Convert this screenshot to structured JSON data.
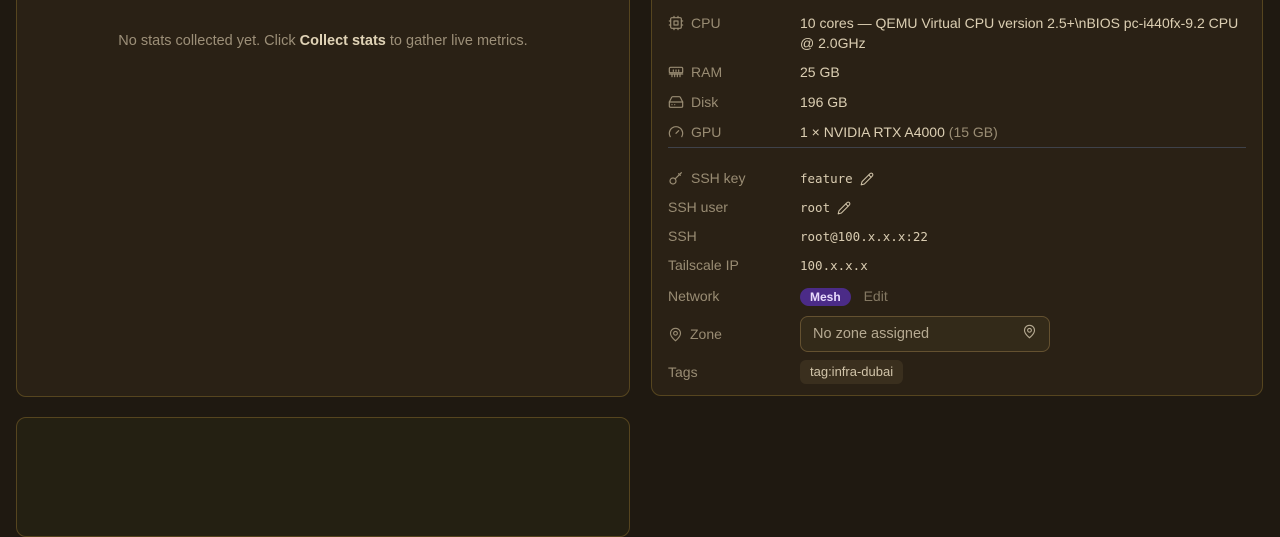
{
  "theme": {
    "page_bg": "#1f1911",
    "panel_bg": "#2a2115",
    "panel_border": "#56451f",
    "value_text": "#dbceb2",
    "label_text": "#998c73",
    "badge_bg": "#4b2b87",
    "badge_text": "#e7dafb"
  },
  "stats_panel": {
    "message_prefix": "No stats collected yet. Click ",
    "message_bold": "Collect stats",
    "message_suffix": " to gather live metrics."
  },
  "details_panel": {
    "hardware": {
      "cpu": {
        "icon": "cpu-icon",
        "label": "CPU",
        "value": "10 cores — QEMU Virtual CPU version 2.5+\\nBIOS pc-i440fx-9.2 CPU @ 2.0GHz"
      },
      "ram": {
        "icon": "ram-icon",
        "label": "RAM",
        "value": "25 GB"
      },
      "disk": {
        "icon": "disk-icon",
        "label": "Disk",
        "value": "196 GB"
      },
      "gpu": {
        "icon": "gpu-icon",
        "label": "GPU",
        "value": "1 × NVIDIA RTX A4000",
        "value_suffix": "(15 GB)"
      }
    },
    "connection": {
      "ssh_key": {
        "icon": "key-icon",
        "label": "SSH key",
        "value": "feature"
      },
      "ssh_user": {
        "label": "SSH user",
        "value": "root"
      },
      "ssh": {
        "label": "SSH",
        "value": "root@100.x.x.x:22"
      },
      "tailscale_ip": {
        "label": "Tailscale IP",
        "value": "100.x.x.x"
      }
    },
    "network": {
      "label": "Network",
      "badge": "Mesh",
      "edit_label": "Edit"
    },
    "zone": {
      "icon": "map-pin-icon",
      "label": "Zone",
      "placeholder": "No zone assigned"
    },
    "tags": {
      "label": "Tags",
      "items": [
        "tag:infra-dubai"
      ]
    }
  }
}
